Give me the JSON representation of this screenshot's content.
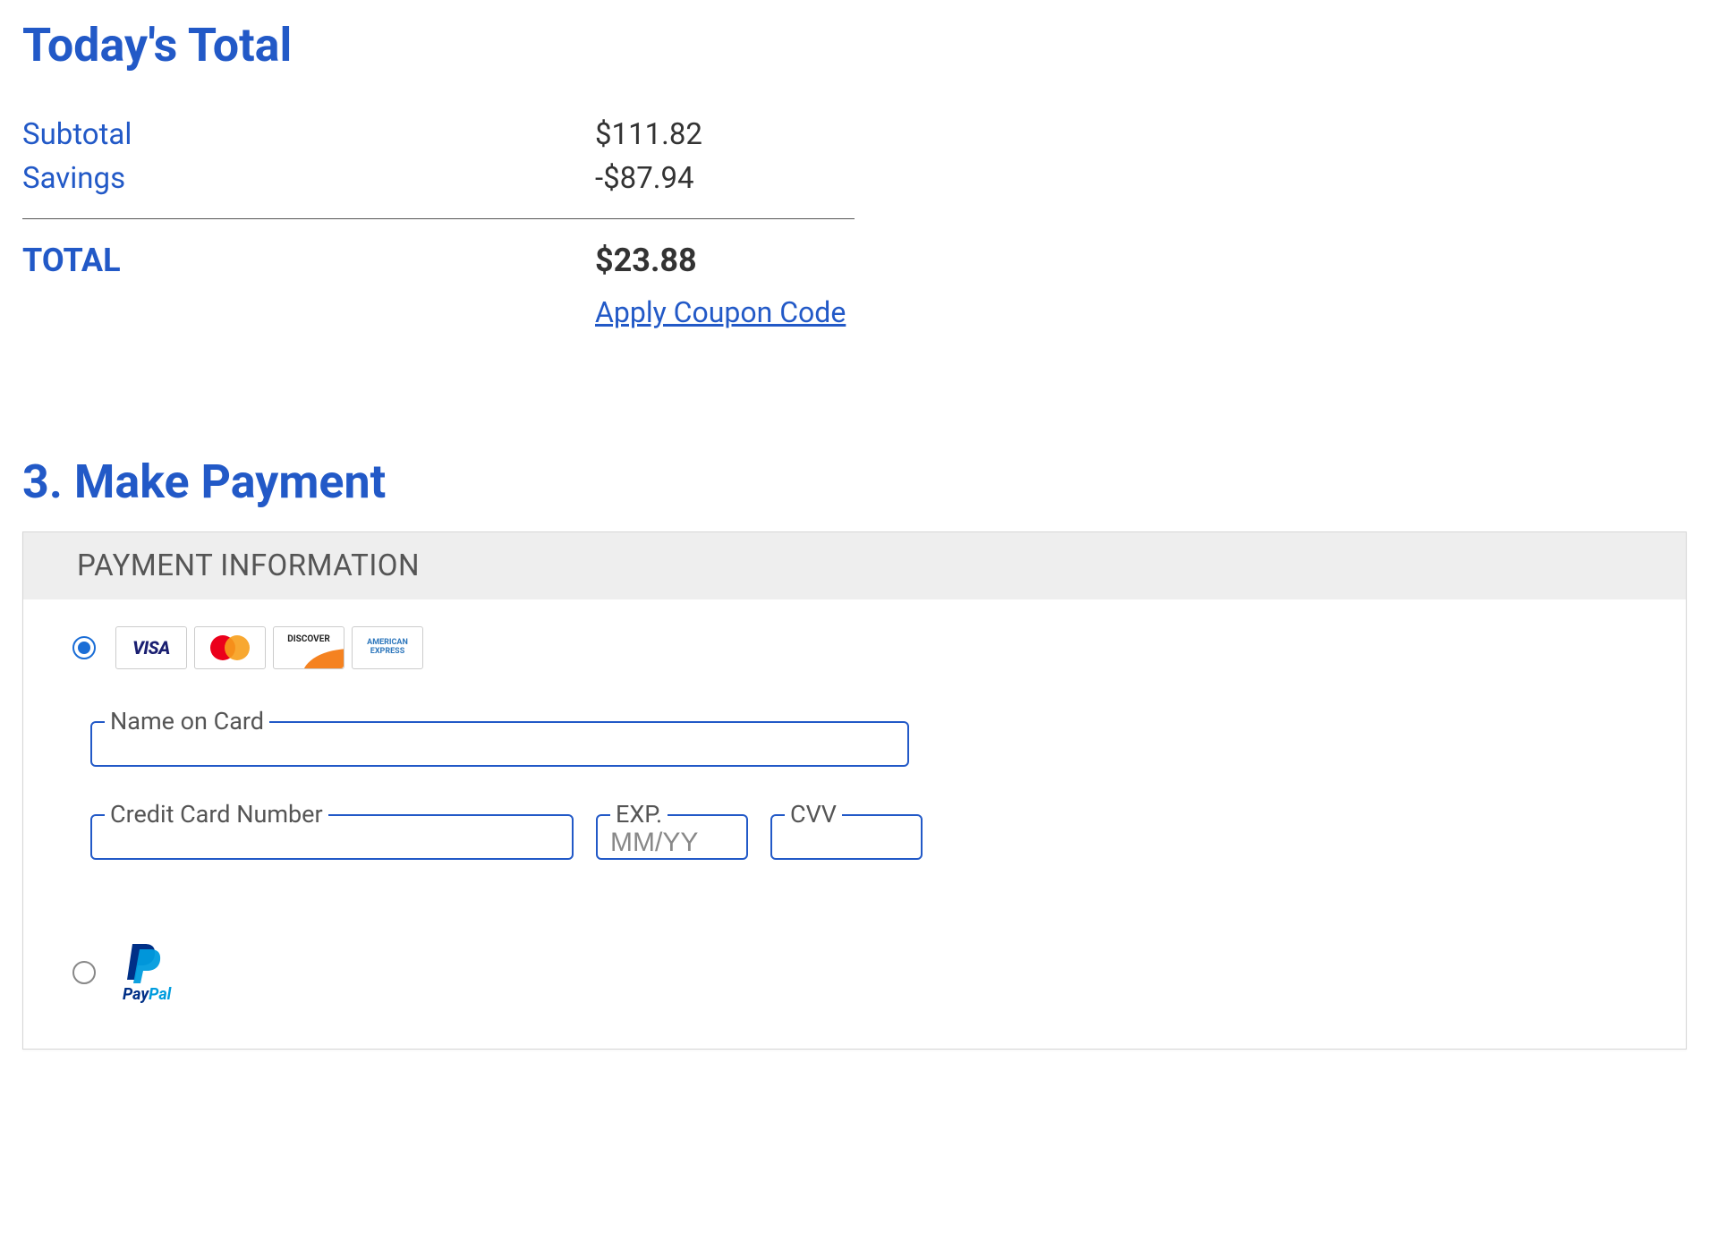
{
  "totals": {
    "heading": "Today's Total",
    "subtotal_label": "Subtotal",
    "subtotal_value": "$111.82",
    "savings_label": "Savings",
    "savings_value": "-$87.94",
    "total_label": "TOTAL",
    "total_value": "$23.88",
    "coupon_link": "Apply Coupon Code"
  },
  "payment": {
    "heading": "3. Make Payment",
    "panel_title": "PAYMENT INFORMATION",
    "card_brands": {
      "visa": "VISA",
      "mastercard": "MasterCard",
      "discover": "DISCOVER",
      "amex": "AMERICAN EXPRESS"
    },
    "fields": {
      "name_label": "Name on Card",
      "name_value": "",
      "cc_label": "Credit Card Number",
      "cc_value": "",
      "exp_label": "EXP.",
      "exp_placeholder": "MM/YY",
      "exp_value": "",
      "cvv_label": "CVV",
      "cvv_value": ""
    },
    "paypal": {
      "pay": "Pay",
      "pal": "Pal"
    }
  }
}
